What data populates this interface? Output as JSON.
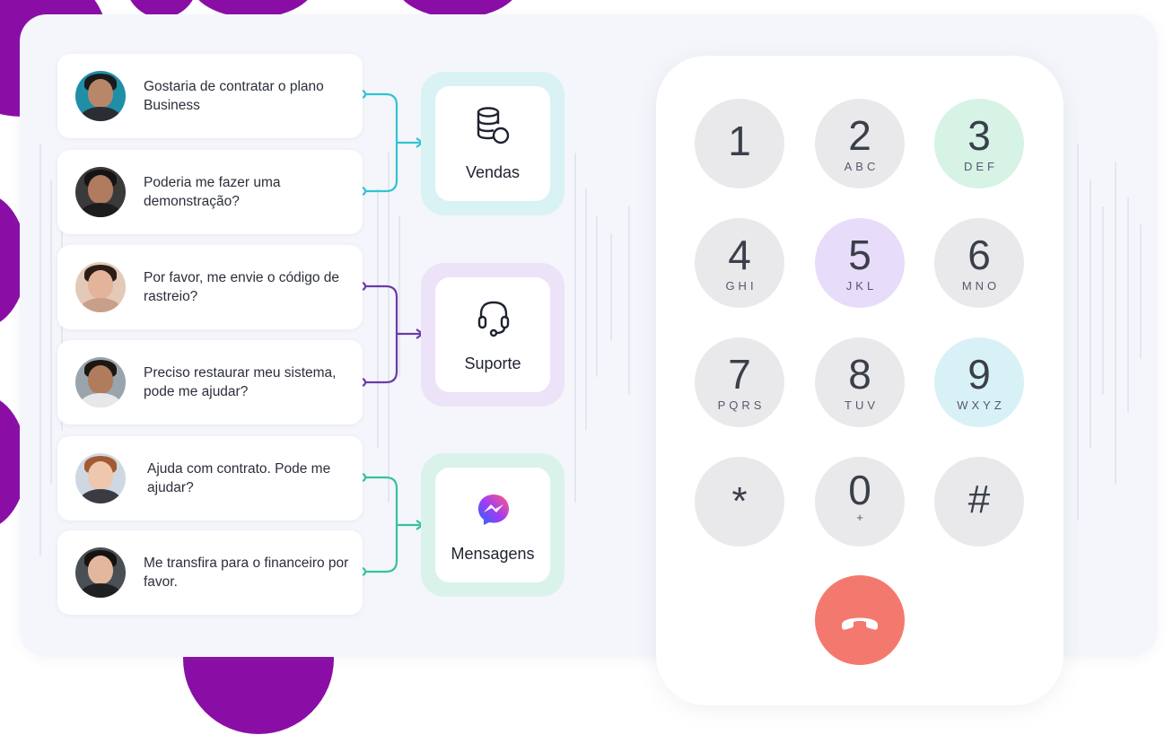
{
  "chats": [
    {
      "text": "Gostaria de contratar o plano Business"
    },
    {
      "text": "Poderia me fazer uma demonstração?"
    },
    {
      "text": "Por favor, me envie o código de rastreio?"
    },
    {
      "text": "Preciso restaurar meu sistema, pode me ajudar?"
    },
    {
      "text": "Ajuda com contrato. Pode me ajudar?"
    },
    {
      "text": "Me transfira para o financeiro por favor."
    }
  ],
  "routes": [
    {
      "label": "Vendas",
      "icon": "database-icon",
      "color": "#2fc4d2"
    },
    {
      "label": "Suporte",
      "icon": "headset-icon",
      "color": "#6b3aa6"
    },
    {
      "label": "Mensagens",
      "icon": "messenger-icon",
      "color": "#35c29a"
    }
  ],
  "keypad": [
    {
      "num": "1",
      "letters": ""
    },
    {
      "num": "2",
      "letters": "ABC"
    },
    {
      "num": "3",
      "letters": "DEF"
    },
    {
      "num": "4",
      "letters": "GHI"
    },
    {
      "num": "5",
      "letters": "JKL"
    },
    {
      "num": "6",
      "letters": "MNO"
    },
    {
      "num": "7",
      "letters": "PQRS"
    },
    {
      "num": "8",
      "letters": "TUV"
    },
    {
      "num": "9",
      "letters": "WXYZ"
    },
    {
      "num": "*",
      "letters": ""
    },
    {
      "num": "0",
      "letters": "+"
    },
    {
      "num": "#",
      "letters": ""
    }
  ],
  "colors": {
    "brand_purple": "#8a0ea6",
    "key_default": "#e9e9ec",
    "key_3": "#d6f3e6",
    "key_5": "#e8dcfb",
    "key_9": "#d8f1f6",
    "hangup": "#f3796f"
  }
}
